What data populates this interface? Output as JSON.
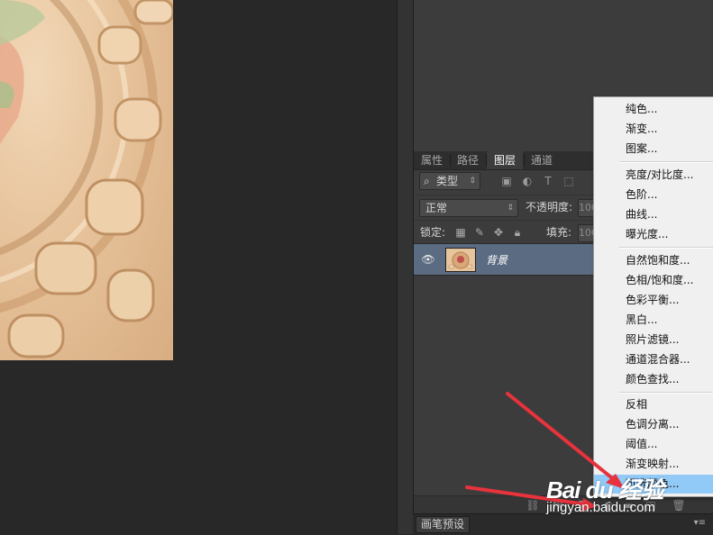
{
  "layers_panel": {
    "tabs": [
      {
        "label": "属性"
      },
      {
        "label": "路径"
      },
      {
        "label": "图层"
      },
      {
        "label": "通道"
      }
    ],
    "filter": {
      "value": "类型",
      "search_icon": "search-icon"
    },
    "filter_icons": [
      "image-filter-icon",
      "adjustment-filter-icon",
      "text-filter-icon",
      "shape-filter-icon"
    ],
    "blend_mode": "正常",
    "opacity_label": "不透明度:",
    "opacity_value": "100",
    "lock_label": "锁定:",
    "lock_icons": [
      "lock-transparent-icon",
      "lock-brush-icon",
      "lock-move-icon",
      "lock-all-icon"
    ],
    "fill_label": "填充:",
    "fill_value": "100",
    "layer": {
      "name": "背景",
      "visible": true,
      "highlight_color": "#5a6b82"
    },
    "bottom_icons": [
      "link-icon",
      "fx-icon",
      "mask-icon",
      "adjustment-layer-icon",
      "group-icon",
      "new-layer-icon",
      "trash-icon"
    ]
  },
  "status_strip": {
    "brush_tab": "画笔预设"
  },
  "context_menu": {
    "highlight_color": "#91c9f7",
    "items": [
      "纯色...",
      "渐变...",
      "图案...",
      "亮度/对比度...",
      "色阶...",
      "曲线...",
      "曝光度...",
      "自然饱和度...",
      "色相/饱和度...",
      "色彩平衡...",
      "黑白...",
      "照片滤镜...",
      "通道混合器...",
      "颜色查找...",
      "反相",
      "色调分离...",
      "阈值...",
      "渐变映射...",
      "可选颜色..."
    ],
    "highlighted_item": "可选颜色..."
  },
  "annotation": {
    "arrow_color": "#e8323c"
  },
  "watermark": {
    "logo": "Bai du 经验",
    "url": "jingyan.baidu.com"
  }
}
